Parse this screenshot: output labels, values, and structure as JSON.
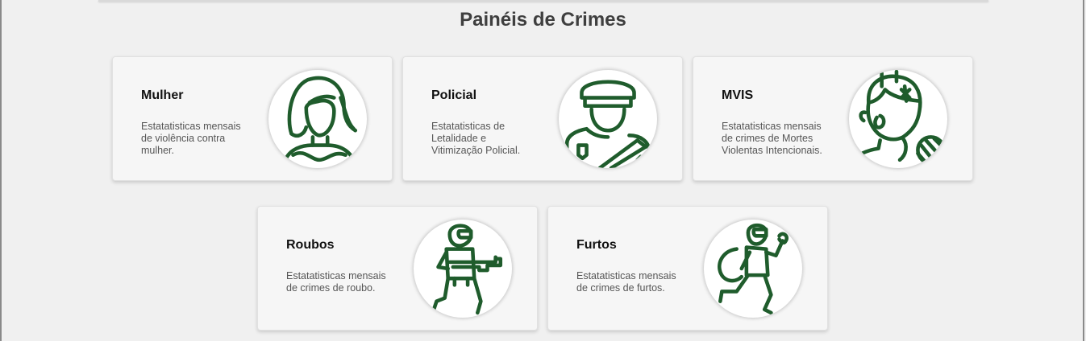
{
  "page": {
    "title": "Painéis de Crimes"
  },
  "cards": [
    {
      "title": "Mulher",
      "description": "Estatatisticas mensais de violência contra mulher.",
      "icon": "woman-icon"
    },
    {
      "title": "Policial",
      "description": "Estatatisticas de Letalidade e Vitimização Policial.",
      "icon": "police-officer-icon"
    },
    {
      "title": "MVIS",
      "description": "Estatatisticas mensais de crimes de Mortes Violentas Intencionais.",
      "icon": "victim-icon"
    },
    {
      "title": "Roubos",
      "description": "Estatatisticas mensais de crimes de roubo.",
      "icon": "armed-robber-icon"
    },
    {
      "title": "Furtos",
      "description": "Estatatisticas mensais de crimes de furtos.",
      "icon": "thief-icon"
    }
  ],
  "colors": {
    "icon_stroke": "#1f5c2c",
    "card_bg": "#f6f6f6",
    "page_bg": "#f0f0f0"
  }
}
